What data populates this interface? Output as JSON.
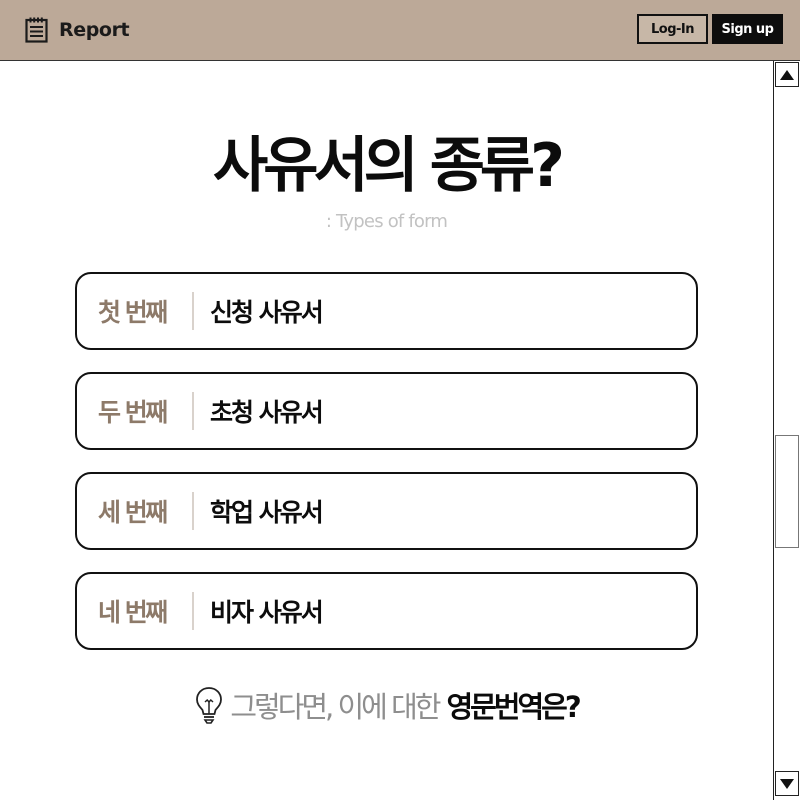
{
  "header": {
    "brand": {
      "icon": "notepad-icon",
      "label": "Report"
    },
    "login_label": "Log-In",
    "signup_label": "Sign up"
  },
  "main": {
    "title": "사유서의 종류?",
    "subtitle": ": Types of form",
    "cards": [
      {
        "ordinal": "첫 번째",
        "label": "신청 사유서"
      },
      {
        "ordinal": "두 번째",
        "label": "초청 사유서"
      },
      {
        "ordinal": "세 번째",
        "label": "학업 사유서"
      },
      {
        "ordinal": "네 번째",
        "label": "비자 사유서"
      }
    ],
    "question": {
      "icon": "lightbulb-icon",
      "light_text": "그렇다면, 이에 대한",
      "bold_text": "영문번역은?"
    }
  },
  "scrollbar": {
    "up_icon": "triangle-up-icon",
    "down_icon": "triangle-down-icon"
  },
  "colors": {
    "header_bg": "#bca998",
    "accent_brown": "#8d7a69",
    "dark": "#0d0d0d",
    "subtitle_gray": "#c2c2c2",
    "question_gray": "#8e8e8e"
  }
}
